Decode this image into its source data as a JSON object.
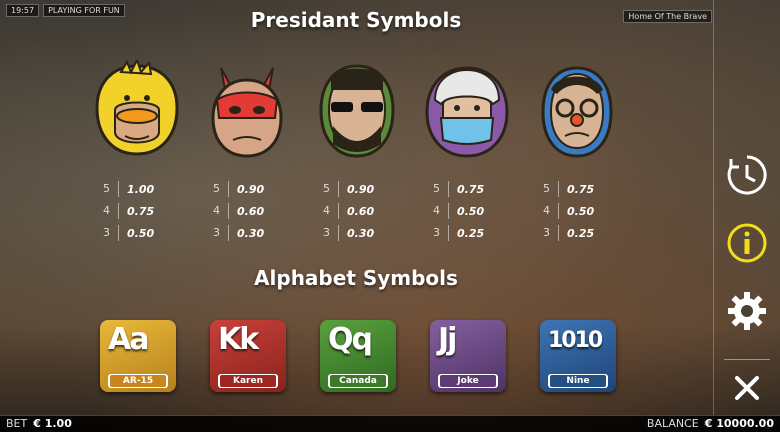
{
  "status": {
    "time": "19:57",
    "mode": "PLAYING FOR FUN",
    "game_name": "Home Of The Brave"
  },
  "titles": {
    "presidents": "Presidant Symbols",
    "alphabet": "Alphabet Symbols"
  },
  "presidents": [
    {
      "name": "duck-mask-president",
      "payouts": [
        {
          "count": "5",
          "value": "1.00"
        },
        {
          "count": "4",
          "value": "0.75"
        },
        {
          "count": "3",
          "value": "0.50"
        }
      ]
    },
    {
      "name": "bunny-mask-president",
      "payouts": [
        {
          "count": "5",
          "value": "0.90"
        },
        {
          "count": "4",
          "value": "0.60"
        },
        {
          "count": "3",
          "value": "0.30"
        }
      ]
    },
    {
      "name": "lincoln-sunglasses-president",
      "payouts": [
        {
          "count": "5",
          "value": "0.90"
        },
        {
          "count": "4",
          "value": "0.60"
        },
        {
          "count": "3",
          "value": "0.30"
        }
      ]
    },
    {
      "name": "washington-face-mask-president",
      "payouts": [
        {
          "count": "5",
          "value": "0.75"
        },
        {
          "count": "4",
          "value": "0.50"
        },
        {
          "count": "3",
          "value": "0.25"
        }
      ]
    },
    {
      "name": "nixon-glasses-president",
      "payouts": [
        {
          "count": "5",
          "value": "0.75"
        },
        {
          "count": "4",
          "value": "0.50"
        },
        {
          "count": "3",
          "value": "0.25"
        }
      ]
    }
  ],
  "alphabet": [
    {
      "letters": "Aa",
      "tag": "AR-15",
      "color": "#d6a12a",
      "tag_color": "#c9861d"
    },
    {
      "letters": "Kk",
      "tag": "Karen",
      "color": "#b3312a",
      "tag_color": "#9e2520"
    },
    {
      "letters": "Qq",
      "tag": "Canada",
      "color": "#4a8f33",
      "tag_color": "#3c7a29"
    },
    {
      "letters": "Jj",
      "tag": "Joke",
      "color": "#6f4a8a",
      "tag_color": "#5c3b75"
    },
    {
      "letters": "1010",
      "tag": "Nine",
      "color": "#2d5f9a",
      "tag_color": "#244f82"
    }
  ],
  "bet": {
    "label": "BET",
    "value": "€ 1.00"
  },
  "balance": {
    "label": "BALANCE",
    "value": "€ 10000.00"
  },
  "side": {
    "history_icon": "clock-history-icon",
    "info_icon": "info-icon",
    "settings_icon": "gear-icon",
    "close_icon": "close-icon",
    "info_color": "#f2dc1c"
  }
}
